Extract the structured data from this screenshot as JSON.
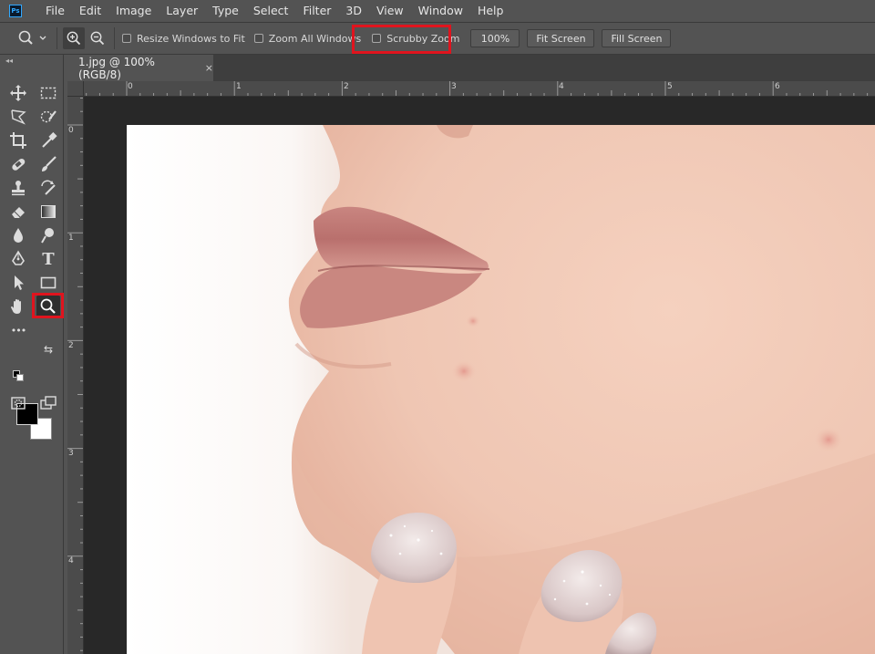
{
  "app": {
    "logo_text": "Ps"
  },
  "menu": [
    "File",
    "Edit",
    "Image",
    "Layer",
    "Type",
    "Select",
    "Filter",
    "3D",
    "View",
    "Window",
    "Help"
  ],
  "options_bar": {
    "resize_windows_label": "Resize Windows to Fit",
    "zoom_all_windows_label": "Zoom All Windows",
    "scrubby_zoom_label": "Scrubby Zoom",
    "zoom_100_label": "100%",
    "fit_screen_label": "Fit Screen",
    "fill_screen_label": "Fill Screen",
    "resize_windows_checked": false,
    "zoom_all_windows_checked": false,
    "scrubby_zoom_checked": false,
    "highlighted": "Scrubby Zoom"
  },
  "document": {
    "tab_title": "1.jpg @ 100% (RGB/8)",
    "close_glyph": "×"
  },
  "rulers": {
    "top_labels": [
      "0",
      "1",
      "2",
      "3",
      "4",
      "5",
      "6"
    ],
    "left_labels": [
      "0",
      "1",
      "2",
      "3",
      "4"
    ]
  },
  "toolbar": {
    "tools": [
      "move",
      "marquee",
      "lasso",
      "quick-selection",
      "crop",
      "eyedropper",
      "healing",
      "brush",
      "stamp",
      "history-brush",
      "eraser",
      "gradient",
      "blur",
      "dodge",
      "pen",
      "type",
      "path-selection",
      "rectangle",
      "hand",
      "zoom",
      "more"
    ],
    "active_tool": "zoom",
    "type_glyph": "T",
    "more_glyph": "•••",
    "swap_glyph": "⇆",
    "foreground_color": "#000000",
    "background_color": "#ffffff"
  },
  "colors": {
    "highlight": "#e0141e",
    "chrome": "#535353",
    "canvas_bg": "#282828"
  }
}
